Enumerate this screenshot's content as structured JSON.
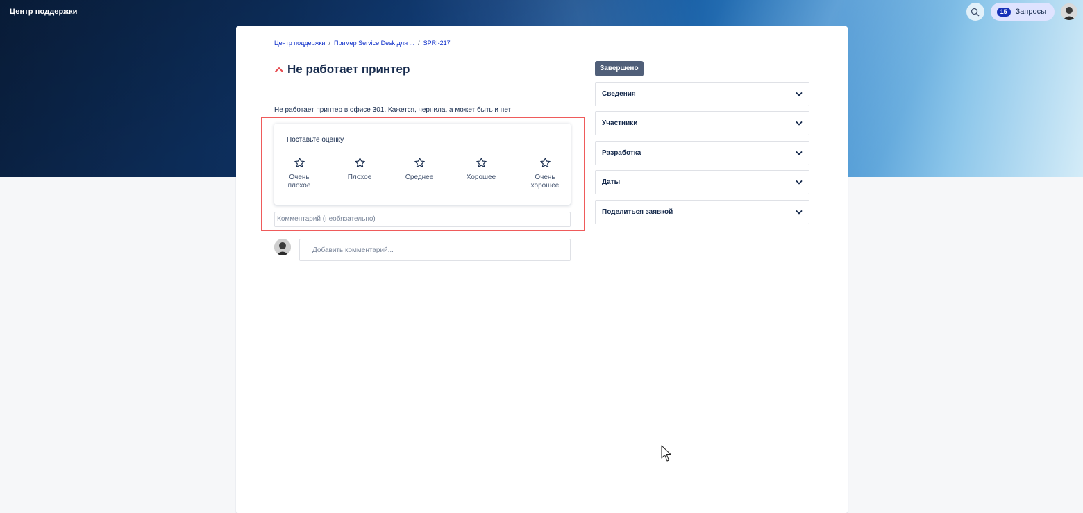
{
  "header": {
    "brand": "Центр поддержки",
    "requests_count": "15",
    "requests_label": "Запросы"
  },
  "breadcrumb": {
    "items": [
      "Центр поддержки",
      "Пример Service Desk для ...",
      "SPRI-217"
    ],
    "separator": "/"
  },
  "issue": {
    "title": "Не работает принтер",
    "description": "Не работает принтер в офисе 301. Кажется, чернила, а может быть и нет",
    "status": "Завершено"
  },
  "rating": {
    "prompt": "Поставьте оценку",
    "options": [
      {
        "line1": "Очень",
        "line2": "плохое"
      },
      {
        "line1": "Плохое",
        "line2": ""
      },
      {
        "line1": "Среднее",
        "line2": ""
      },
      {
        "line1": "Хорошее",
        "line2": ""
      },
      {
        "line1": "Очень",
        "line2": "хорошее"
      }
    ],
    "comment_placeholder": "Комментарий (необязательно)"
  },
  "comments": {
    "placeholder": "Добавить комментарий..."
  },
  "sidebar": {
    "panels": [
      {
        "label": "Сведения"
      },
      {
        "label": "Участники"
      },
      {
        "label": "Разработка"
      },
      {
        "label": "Даты"
      },
      {
        "label": "Поделиться заявкой"
      }
    ]
  },
  "colors": {
    "link": "#0b2cc9",
    "priority": "#e5484d",
    "highlight_border": "#ef5b5b",
    "status_bg": "#505f79",
    "badge_bg": "#1732b8"
  },
  "icons": {
    "priority": "chevron-up-icon",
    "rating": "star-outline-icon",
    "panel_toggle": "chevron-down-icon",
    "search": "search-icon"
  }
}
